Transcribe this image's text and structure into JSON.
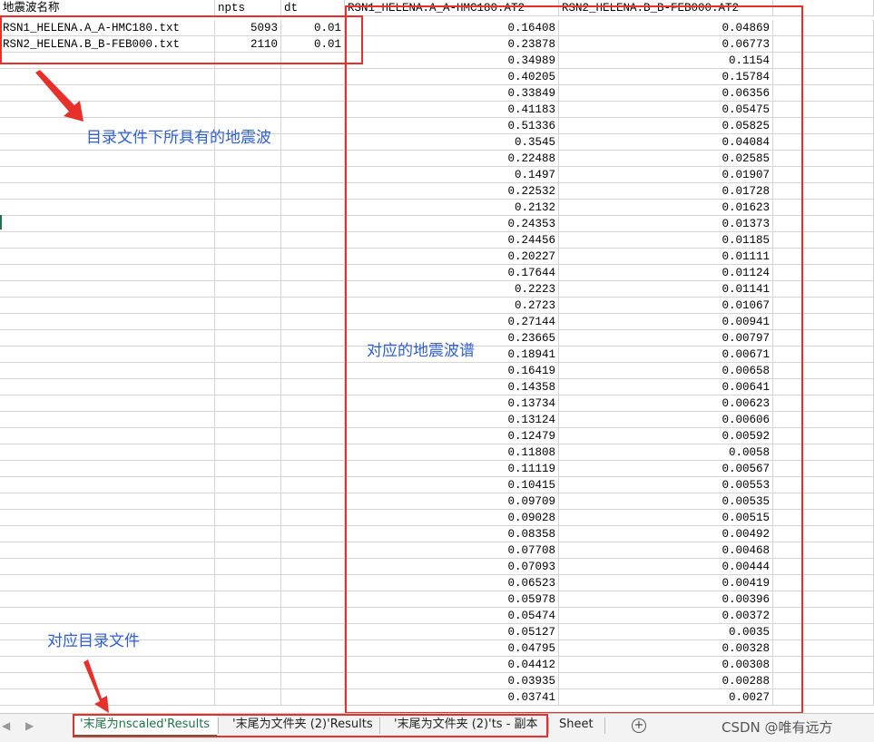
{
  "headers": {
    "col_a": "地震波名称",
    "col_b": "npts",
    "col_c": "dt",
    "col_d": "RSN1_HELENA.A_A-HMC180.AT2",
    "col_e": "RSN2_HELENA.B_B-FEB000.AT2"
  },
  "files": [
    {
      "name": "RSN1_HELENA.A_A-HMC180.txt",
      "npts": "5093",
      "dt": "0.01"
    },
    {
      "name": "RSN2_HELENA.B_B-FEB000.txt",
      "npts": "2110",
      "dt": "0.01"
    }
  ],
  "spectrum": {
    "col_d": [
      "0.16408",
      "0.23878",
      "0.34989",
      "0.40205",
      "0.33849",
      "0.41183",
      "0.51336",
      "0.3545",
      "0.22488",
      "0.1497",
      "0.22532",
      "0.2132",
      "0.24353",
      "0.24456",
      "0.20227",
      "0.17644",
      "0.2223",
      "0.2723",
      "0.27144",
      "0.23665",
      "0.18941",
      "0.16419",
      "0.14358",
      "0.13734",
      "0.13124",
      "0.12479",
      "0.11808",
      "0.11119",
      "0.10415",
      "0.09709",
      "0.09028",
      "0.08358",
      "0.07708",
      "0.07093",
      "0.06523",
      "0.05978",
      "0.05474",
      "0.05127",
      "0.04795",
      "0.04412",
      "0.03935",
      "0.03741"
    ],
    "col_e": [
      "0.04869",
      "0.06773",
      "0.1154",
      "0.15784",
      "0.06356",
      "0.05475",
      "0.05825",
      "0.04084",
      "0.02585",
      "0.01907",
      "0.01728",
      "0.01623",
      "0.01373",
      "0.01185",
      "0.01111",
      "0.01124",
      "0.01141",
      "0.01067",
      "0.00941",
      "0.00797",
      "0.00671",
      "0.00658",
      "0.00641",
      "0.00623",
      "0.00606",
      "0.00592",
      "0.0058",
      "0.00567",
      "0.00553",
      "0.00535",
      "0.00515",
      "0.00492",
      "0.00468",
      "0.00444",
      "0.00419",
      "0.00396",
      "0.00372",
      "0.0035",
      "0.00328",
      "0.00308",
      "0.00288",
      "0.0027"
    ]
  },
  "annotations": {
    "files_note": "目录文件下所具有的地震波",
    "spectrum_note": "对应的地震波谱",
    "folder_note": "对应目录文件"
  },
  "tabs": [
    {
      "label": "'末尾为nscaled'Results",
      "active": true
    },
    {
      "label": "'末尾为文件夹 (2)'Results",
      "active": false
    },
    {
      "label": "'末尾为文件夹 (2)'ts - 副本",
      "active": false
    },
    {
      "label": "Sheet",
      "active": false
    }
  ],
  "nav": {
    "prev": "◀",
    "next": "▶",
    "add": "+"
  },
  "watermark": "CSDN @唯有远方",
  "colors": {
    "annotation_red": "#e8302a",
    "annotation_blue": "#2f5fd0",
    "excel_green": "#217346"
  }
}
